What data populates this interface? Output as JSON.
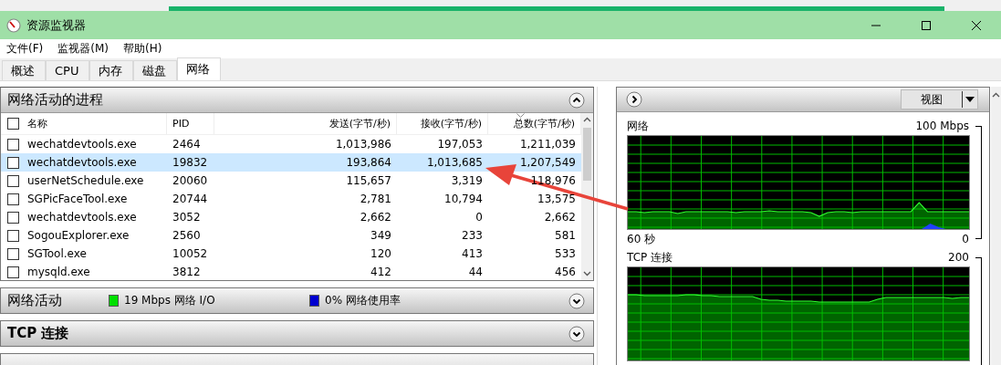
{
  "window": {
    "title": "资源监视器"
  },
  "menu": [
    "文件(F)",
    "监视器(M)",
    "帮助(H)"
  ],
  "tabs": [
    {
      "label": "概述",
      "selected": false
    },
    {
      "label": "CPU",
      "selected": false
    },
    {
      "label": "内存",
      "selected": false
    },
    {
      "label": "磁盘",
      "selected": false
    },
    {
      "label": "网络",
      "selected": true
    }
  ],
  "process_section": {
    "title": "网络活动的进程",
    "expanded": true,
    "header_checked": false,
    "columns": [
      "名称",
      "PID",
      "发送(字节/秒)",
      "接收(字节/秒)",
      "总数(字节/秒)"
    ],
    "rows": [
      {
        "checked": false,
        "selected": false,
        "cells": [
          "wechatdevtools.exe",
          "2464",
          "1,013,986",
          "197,053",
          "1,211,039"
        ]
      },
      {
        "checked": false,
        "selected": true,
        "cells": [
          "wechatdevtools.exe",
          "19832",
          "193,864",
          "1,013,685",
          "1,207,549"
        ]
      },
      {
        "checked": false,
        "selected": false,
        "cells": [
          "userNetSchedule.exe",
          "20060",
          "115,657",
          "3,319",
          "118,976"
        ]
      },
      {
        "checked": false,
        "selected": false,
        "cells": [
          "SGPicFaceTool.exe",
          "20744",
          "2,781",
          "10,794",
          "13,575"
        ]
      },
      {
        "checked": false,
        "selected": false,
        "cells": [
          "wechatdevtools.exe",
          "3052",
          "2,662",
          "0",
          "2,662"
        ]
      },
      {
        "checked": false,
        "selected": false,
        "cells": [
          "SogouExplorer.exe",
          "2560",
          "349",
          "233",
          "581"
        ]
      },
      {
        "checked": false,
        "selected": false,
        "cells": [
          "SGTool.exe",
          "10052",
          "120",
          "413",
          "533"
        ]
      },
      {
        "checked": false,
        "selected": false,
        "cells": [
          "mysqld.exe",
          "3812",
          "412",
          "44",
          "456"
        ]
      }
    ]
  },
  "collapsed_sections": [
    {
      "title": "网络活动",
      "bold": false,
      "expanded": false,
      "legend": [
        {
          "text": "19 Mbps 网络 I/O",
          "color": "#00e000"
        },
        {
          "text": "0% 网络使用率",
          "color": "#0000d0"
        }
      ]
    },
    {
      "title": "TCP 连接",
      "bold": true,
      "expanded": false
    }
  ],
  "right_panel": {
    "view_button": "视图",
    "charts": [
      {
        "title": "网络",
        "max": "100 Mbps",
        "time": "60 秒",
        "min": "0"
      },
      {
        "title": "TCP 连接",
        "max": "200"
      }
    ]
  }
}
